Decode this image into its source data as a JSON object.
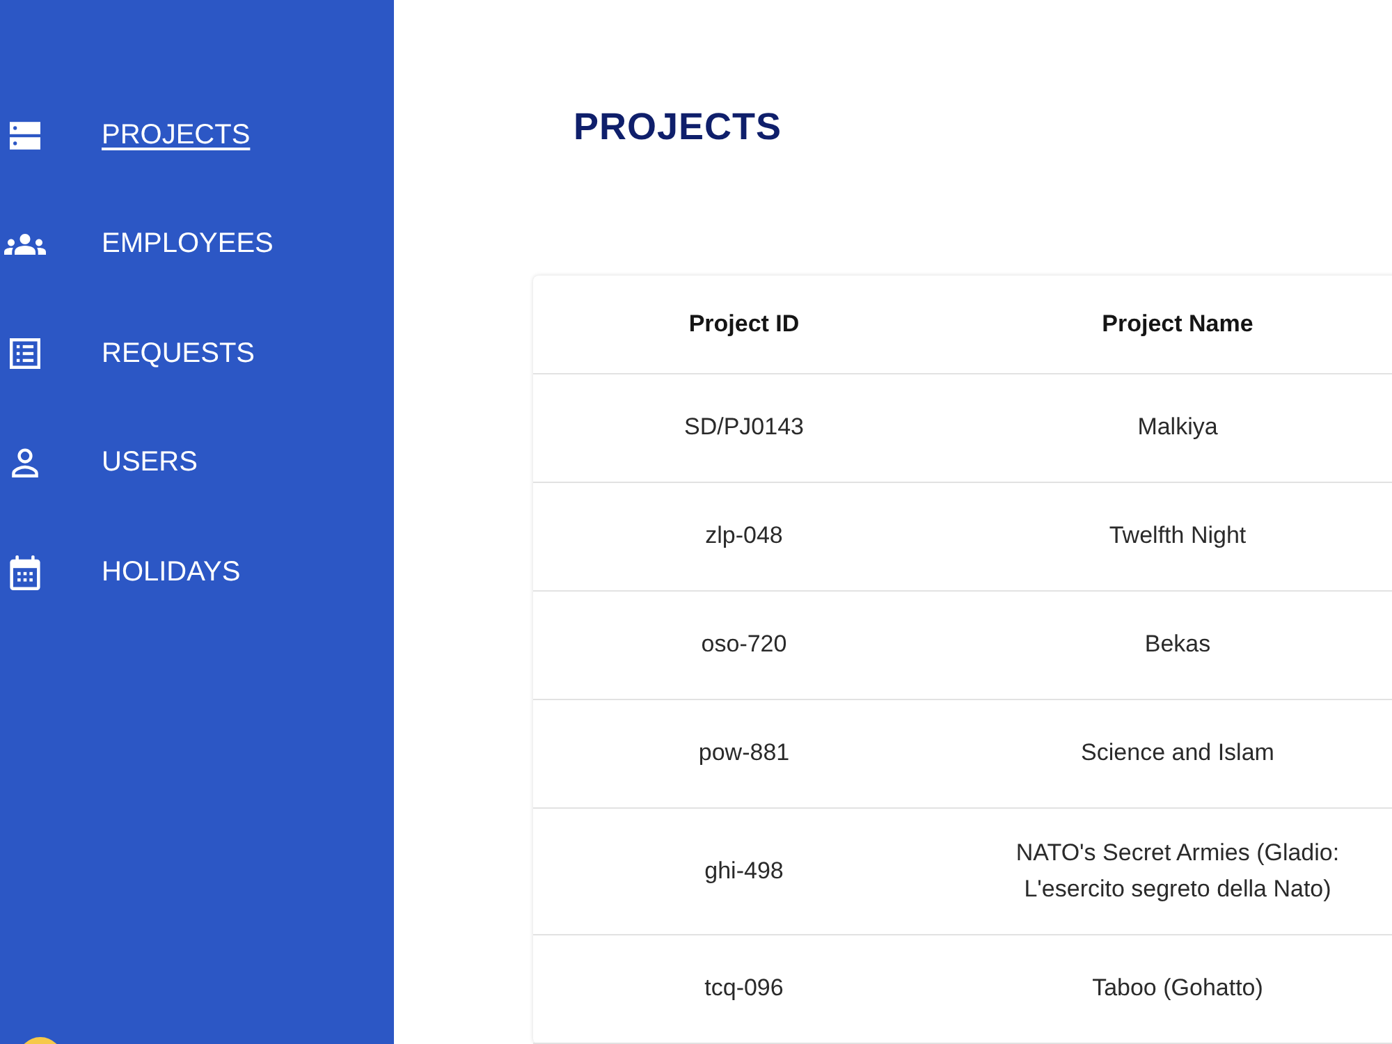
{
  "sidebar": {
    "items": [
      {
        "label": "PROJECTS",
        "selected": true
      },
      {
        "label": "EMPLOYEES",
        "selected": false
      },
      {
        "label": "REQUESTS",
        "selected": false
      },
      {
        "label": "USERS",
        "selected": false
      },
      {
        "label": "HOLIDAYS",
        "selected": false
      }
    ]
  },
  "page_title": "PROJECTS",
  "table": {
    "columns": [
      "Project ID",
      "Project Name"
    ],
    "rows": [
      [
        "SD/PJ0143",
        "Malkiya"
      ],
      [
        "zlp-048",
        "Twelfth Night"
      ],
      [
        "oso-720",
        "Bekas"
      ],
      [
        "pow-881",
        "Science and Islam"
      ],
      [
        "ghi-498",
        "NATO's Secret Armies (Gladio: L'esercito segreto della Nato)"
      ],
      [
        "tcq-096",
        "Taboo (Gohatto)"
      ]
    ]
  }
}
